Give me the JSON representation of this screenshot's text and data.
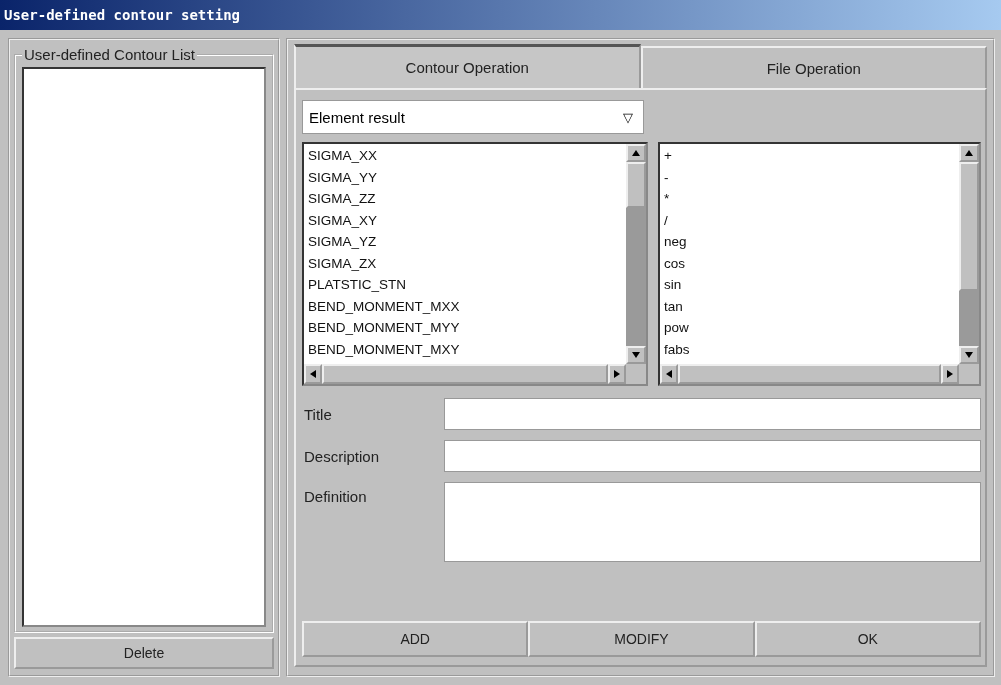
{
  "window": {
    "title": "User-defined contour setting"
  },
  "contour_list": {
    "legend": "User-defined Contour List",
    "delete_button": "Delete"
  },
  "tabs": [
    {
      "label": "Contour Operation",
      "selected": true
    },
    {
      "label": "File Operation",
      "selected": false
    }
  ],
  "result_dropdown": {
    "value": "Element result",
    "arrow": "▽"
  },
  "result_list": [
    "SIGMA_XX",
    "SIGMA_YY",
    "SIGMA_ZZ",
    "SIGMA_XY",
    "SIGMA_YZ",
    "SIGMA_ZX",
    "PLATSTIC_STN",
    "BEND_MONMENT_MXX",
    "BEND_MONMENT_MYY",
    "BEND_MONMENT_MXY"
  ],
  "operator_list": [
    "+",
    "-",
    "*",
    "/",
    "neg",
    "cos",
    "sin",
    "tan",
    "pow",
    "fabs"
  ],
  "fields": [
    {
      "label": "Title",
      "kind": "line"
    },
    {
      "label": "Description",
      "kind": "line"
    },
    {
      "label": "Definition",
      "kind": "area"
    }
  ],
  "buttons": [
    "ADD",
    "MODIFY",
    "OK"
  ]
}
